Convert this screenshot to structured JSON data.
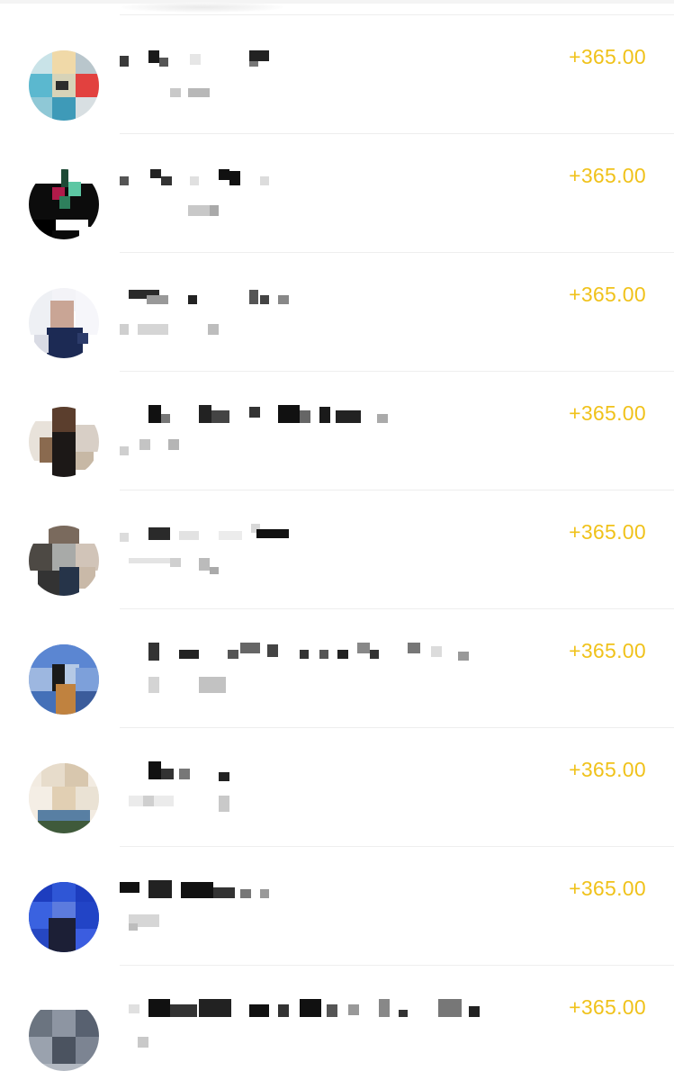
{
  "colors": {
    "amount": "#f0c21b",
    "divider": "#eeeeee",
    "background": "#ffffff"
  },
  "transactions": [
    {
      "amount": "+365.00",
      "avatar": "pixelated-avatar-1",
      "name": "",
      "detail": ""
    },
    {
      "amount": "+365.00",
      "avatar": "pixelated-avatar-2",
      "name": "",
      "detail": ""
    },
    {
      "amount": "+365.00",
      "avatar": "pixelated-avatar-3",
      "name": "",
      "detail": ""
    },
    {
      "amount": "+365.00",
      "avatar": "pixelated-avatar-4",
      "name": "",
      "detail": ""
    },
    {
      "amount": "+365.00",
      "avatar": "pixelated-avatar-5",
      "name": "",
      "detail": ""
    },
    {
      "amount": "+365.00",
      "avatar": "pixelated-avatar-6",
      "name": "",
      "detail": ""
    },
    {
      "amount": "+365.00",
      "avatar": "pixelated-avatar-7",
      "name": "",
      "detail": ""
    },
    {
      "amount": "+365.00",
      "avatar": "pixelated-avatar-8",
      "name": "",
      "detail": ""
    },
    {
      "amount": "+365.00",
      "avatar": "pixelated-avatar-9",
      "name": "",
      "detail": ""
    }
  ]
}
